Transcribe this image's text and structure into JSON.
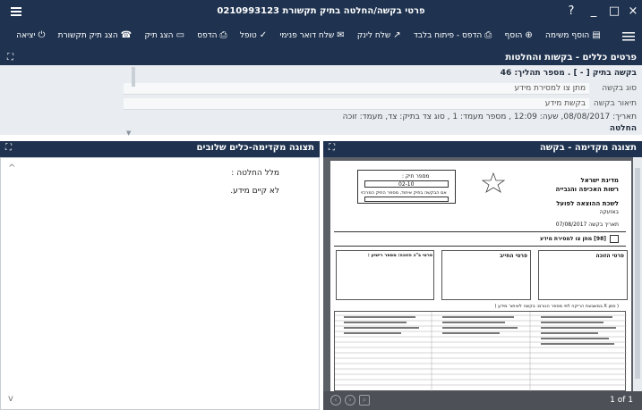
{
  "window": {
    "title": "פרטי בקשה/החלטה בתיק תקשורת 0210993123",
    "controls": {
      "help": "?",
      "minimize": "_",
      "maximize": "□",
      "close": "×"
    }
  },
  "toolbar": {
    "tools": [
      {
        "label": "הוסף משימה",
        "icon": "add-task-icon",
        "glyph": "▤"
      },
      {
        "label": "הוסף",
        "icon": "add-icon",
        "glyph": "⊕"
      },
      {
        "label": "הדפס - פיתוח בלבד",
        "icon": "print-dev-icon",
        "glyph": "⎙"
      },
      {
        "label": "שלח לינק",
        "icon": "send-link-icon",
        "glyph": "↗"
      },
      {
        "label": "שלח דואר פנימי",
        "icon": "internal-mail-icon",
        "glyph": "✉"
      },
      {
        "label": "טופל",
        "icon": "check-icon",
        "glyph": "✓"
      },
      {
        "label": "הדפס",
        "icon": "print-icon",
        "glyph": "⎙"
      },
      {
        "label": "הצג תיק",
        "icon": "view-case-icon",
        "glyph": "▭"
      },
      {
        "label": "הצג תיק תקשורת",
        "icon": "view-comm-case-icon",
        "glyph": "☎"
      },
      {
        "label": "יציאה",
        "icon": "exit-icon",
        "glyph": "⏻"
      }
    ]
  },
  "section_header": {
    "title": "פרטים כללים - בקשות והחלטות"
  },
  "details": {
    "heading": "בקשה בתיק [ - ] . מספר תהליך: 46",
    "request_type_label": "סוג בקשה",
    "request_type_value": "מתן צו למסירת מידע",
    "request_desc_label": "תיאור בקשה",
    "request_desc_value": "בקשת מידע",
    "date_line": "תאריך: 08/08/2017, שעה: 12:09 , מספר מעמד: 1 , סוג צד בתיק: צד, מעמד: זוכה",
    "decision_label": "החלטה"
  },
  "left_pane": {
    "title": "תצוגה מקדימה-כלים שלובים",
    "line1": "מלל החלטה :",
    "line2": "לא קיים מידע."
  },
  "right_pane": {
    "title": "תצוגה מקדימה - בקשה",
    "page_counter": "1 of 1",
    "doc": {
      "case_no_label": "מספר תיק :",
      "case_no_value": "02-10",
      "case_sub": "אם הבקשה בתיק איחוד, מספר התיק המרכזי",
      "org1": "מדינת ישראל",
      "org2": "רשות האכיפה והגבייה",
      "office1": "לשכת ההוצאה לפועל",
      "office2": "באזעקה",
      "date": "תאריך בקשה 07/08/2017",
      "form_title": "[98] מתן צו למסירת מידע",
      "applicant": "פרטי הזוכה",
      "debtor": "פרטי החייב",
      "attorney": "פרטי ב\"כ הזוכה: מספר רישיון :",
      "note": "( סמן X במשבצת הריקה לפי מספר הגורם: בקשה לאיתור מידע )"
    }
  }
}
